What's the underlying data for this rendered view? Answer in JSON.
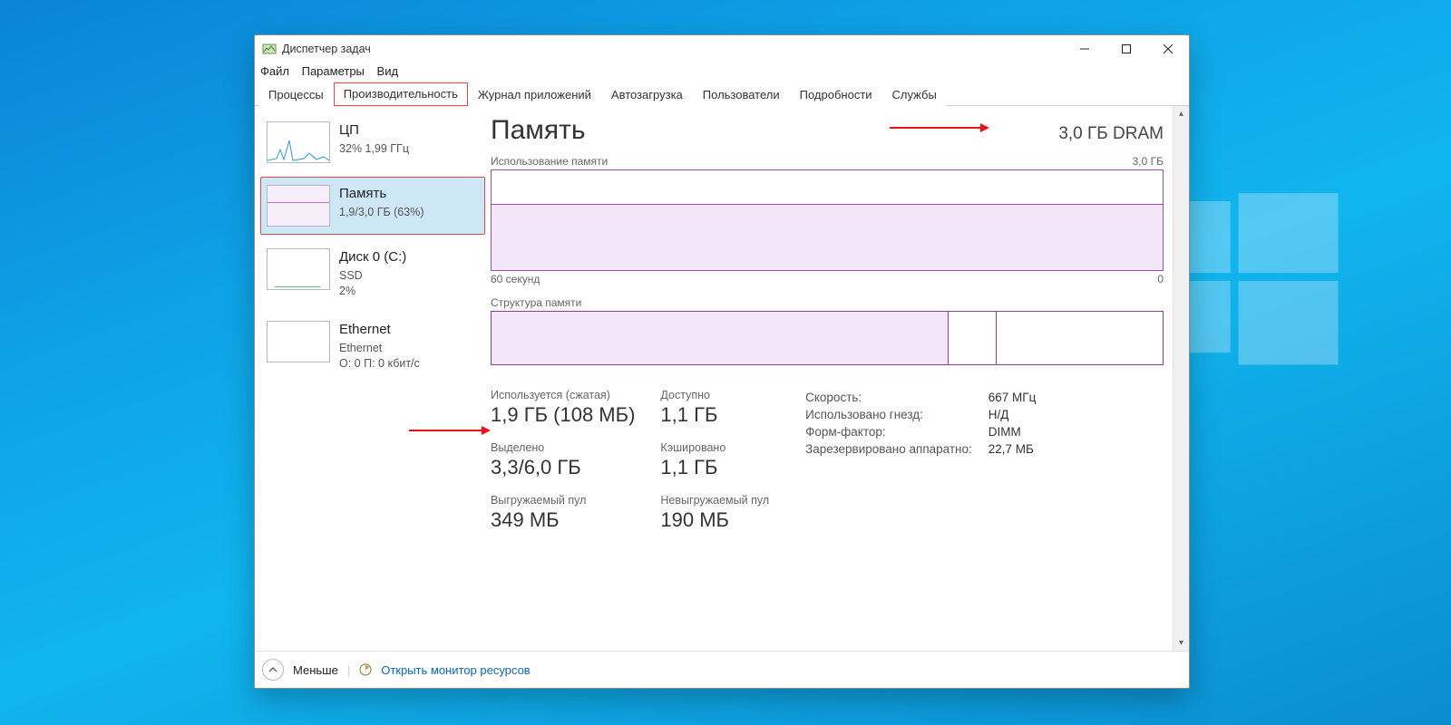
{
  "window": {
    "title": "Диспетчер задач",
    "menus": [
      "Файл",
      "Параметры",
      "Вид"
    ],
    "tabs": [
      "Процессы",
      "Производительность",
      "Журнал приложений",
      "Автозагрузка",
      "Пользователи",
      "Подробности",
      "Службы"
    ],
    "active_tab": 1
  },
  "sidebar": {
    "items": [
      {
        "name": "ЦП",
        "line": "32%  1,99 ГГц"
      },
      {
        "name": "Память",
        "line": "1,9/3,0 ГБ (63%)"
      },
      {
        "name": "Диск 0 (C:)",
        "sub": "SSD",
        "line": "2%"
      },
      {
        "name": "Ethernet",
        "sub": "Ethernet",
        "line": "О: 0 П: 0 кбит/с"
      }
    ]
  },
  "header": {
    "title": "Память",
    "right": "3,0 ГБ DRAM"
  },
  "graph": {
    "label": "Использование памяти",
    "max": "3,0 ГБ",
    "x_left": "60 секунд",
    "x_right": "0"
  },
  "composition": {
    "label": "Структура памяти"
  },
  "metrics": {
    "used": {
      "label": "Используется (сжатая)",
      "value": "1,9 ГБ (108 МБ)"
    },
    "avail": {
      "label": "Доступно",
      "value": "1,1 ГБ"
    },
    "commit": {
      "label": "Выделено",
      "value": "3,3/6,0 ГБ"
    },
    "cached": {
      "label": "Кэшировано",
      "value": "1,1 ГБ"
    },
    "paged": {
      "label": "Выгружаемый пул",
      "value": "349 МБ"
    },
    "nonpaged": {
      "label": "Невыгружаемый пул",
      "value": "190 МБ"
    }
  },
  "specs": {
    "speed": {
      "label": "Скорость:",
      "value": "667 МГц"
    },
    "slots": {
      "label": "Использовано гнезд:",
      "value": "Н/Д"
    },
    "form": {
      "label": "Форм-фактор:",
      "value": "DIMM"
    },
    "hw": {
      "label": "Зарезервировано аппаратно:",
      "value": "22,7 МБ"
    }
  },
  "footer": {
    "less": "Меньше",
    "link": "Открыть монитор ресурсов"
  },
  "chart_data": {
    "type": "line",
    "title": "Использование памяти",
    "ylabel": "ГБ",
    "ylim": [
      0,
      3.0
    ],
    "xlabel": "Секунд",
    "xlim": [
      60,
      0
    ],
    "series": [
      {
        "name": "Память",
        "approx_value": 1.9,
        "note": "flat line at ~1.9 ГБ over visible window"
      }
    ],
    "composition": {
      "used_pct": 68,
      "standby_pct": 7,
      "free_pct": 25
    }
  }
}
